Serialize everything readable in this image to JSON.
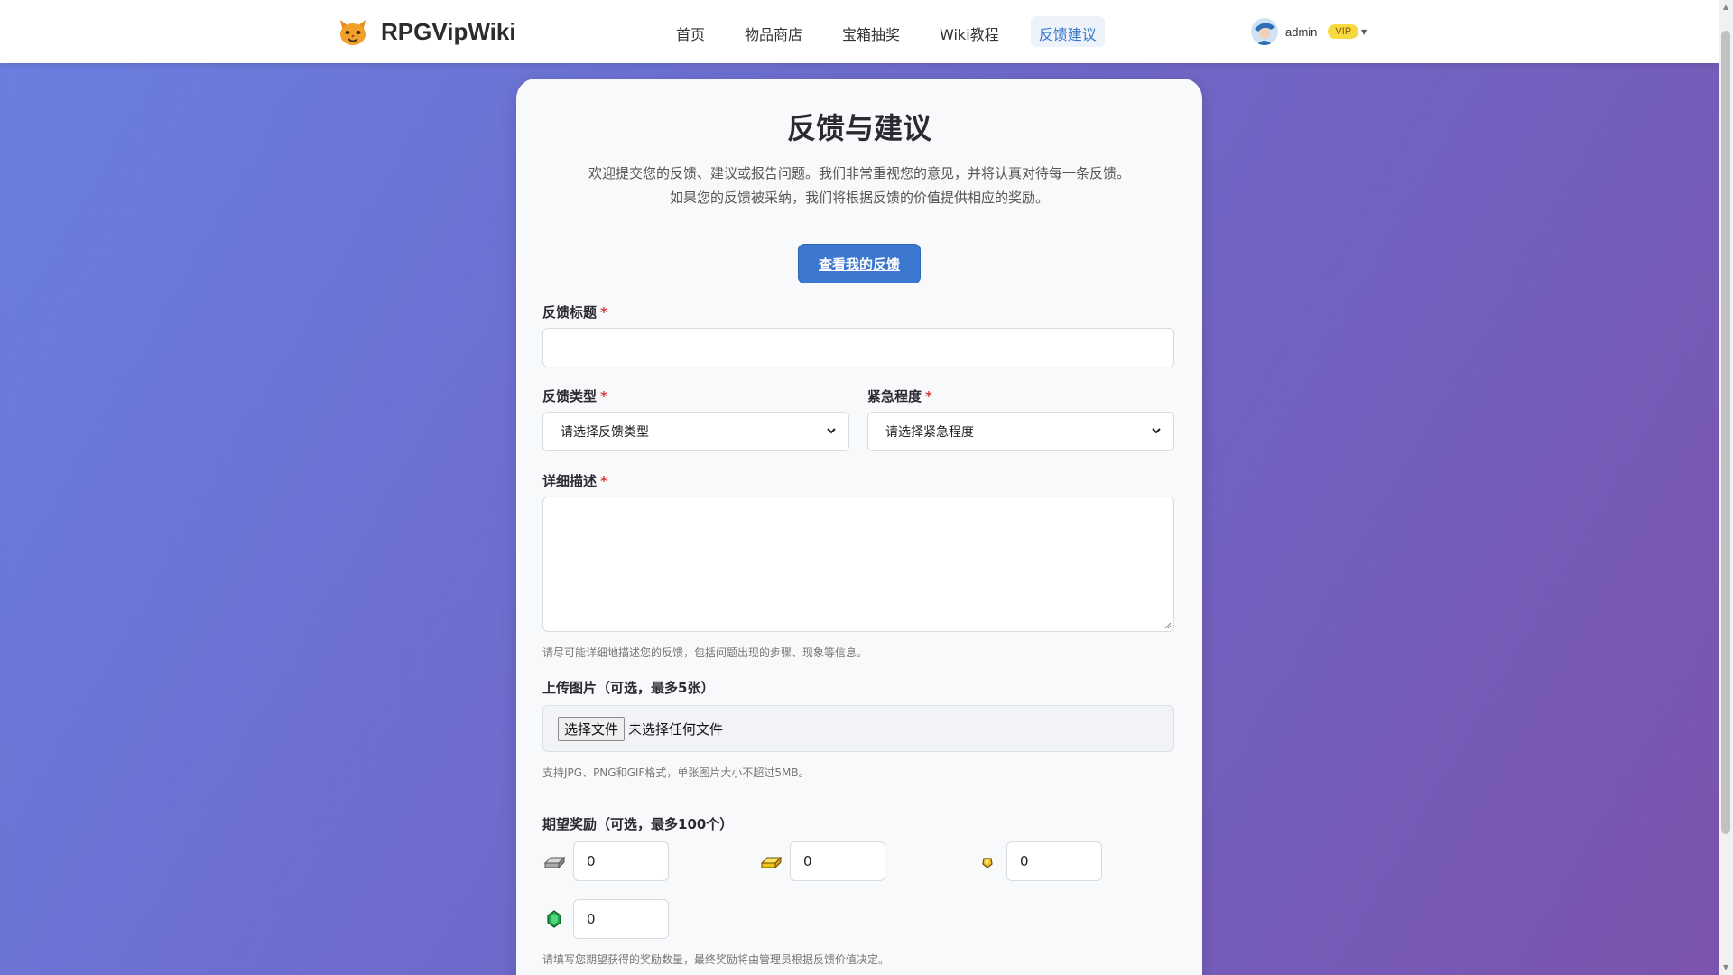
{
  "brand": {
    "name": "RPGVipWiki",
    "logo": "cat-face-icon"
  },
  "nav": {
    "items": [
      {
        "label": "首页"
      },
      {
        "label": "物品商店"
      },
      {
        "label": "宝箱抽奖"
      },
      {
        "label": "Wiki教程"
      },
      {
        "label": "反馈建议",
        "active": true
      }
    ]
  },
  "user": {
    "name": "admin",
    "badge": "VIP",
    "caret": "▾"
  },
  "page": {
    "title": "反馈与建议",
    "intro_line1": "欢迎提交您的反馈、建议或报告问题。我们非常重视您的意见，并将认真对待每一条反馈。",
    "intro_line2": "如果您的反馈被采纳，我们将根据反馈的价值提供相应的奖励。",
    "view_button": "查看我的反馈"
  },
  "form": {
    "title_label": "反馈标题",
    "required_mark": "*",
    "type_label": "反馈类型",
    "type_placeholder": "请选择反馈类型",
    "urgency_label": "紧急程度",
    "urgency_placeholder": "请选择紧急程度",
    "desc_label": "详细描述",
    "desc_help": "请尽可能详细地描述您的反馈，包括问题出现的步骤、现象等信息。",
    "upload_label": "上传图片（可选，最多5张）",
    "file_button": "选择文件",
    "file_status": "未选择任何文件",
    "upload_help": "支持JPG、PNG和GIF格式，单张图片大小不超过5MB。",
    "reward_label": "期望奖励（可选，最多100个）",
    "rewards": [
      {
        "icon": "iron-ingot-icon",
        "value": "0"
      },
      {
        "icon": "gold-ingot-icon",
        "value": "0"
      },
      {
        "icon": "gold-nugget-icon",
        "value": "0"
      },
      {
        "icon": "emerald-icon",
        "value": "0"
      }
    ],
    "reward_help": "请填写您期望获得的奖励数量，最终奖励将由管理员根据反馈价值决定。"
  },
  "colors": {
    "accent": "#3c78d0",
    "required": "#d93030",
    "vip": "#f8d940",
    "bg_start": "#6a7fe0",
    "bg_end": "#7a53ad"
  }
}
